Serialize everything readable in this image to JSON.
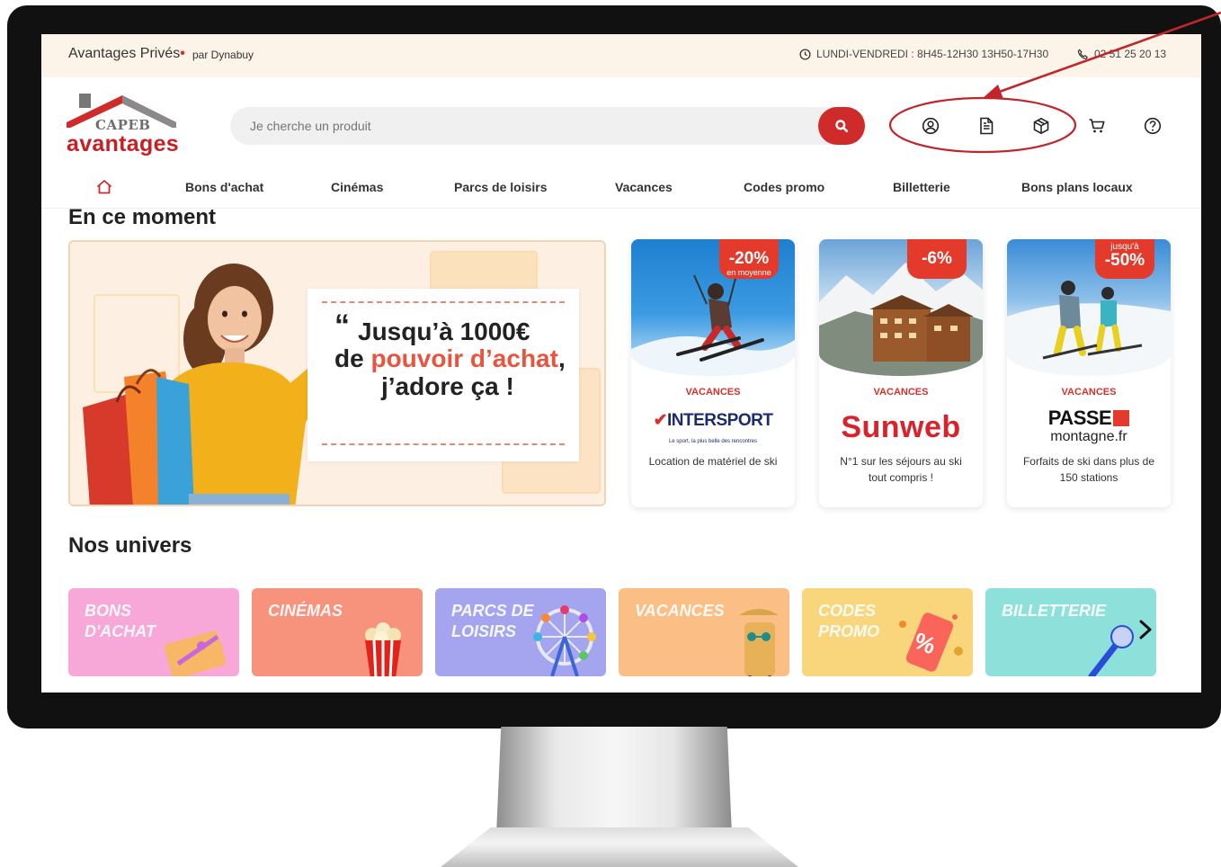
{
  "topbar": {
    "brand": "Avantages Privés",
    "brand_by": "par Dynabuy",
    "hours": "LUNDI-VENDREDI : 8H45-12H30 13H50-17H30",
    "phone": "02 51 25 20 13"
  },
  "logo": {
    "top": "CAPEB",
    "bottom": "avantages"
  },
  "search": {
    "placeholder": "Je cherche un produit"
  },
  "header_icons": [
    "account-icon",
    "document-icon",
    "package-icon",
    "cart-icon",
    "help-icon"
  ],
  "nav": {
    "items": [
      {
        "label": "Bons d'achat"
      },
      {
        "label": "Cinémas"
      },
      {
        "label": "Parcs de loisirs"
      },
      {
        "label": "Vacances"
      },
      {
        "label": "Codes promo"
      },
      {
        "label": "Billetterie"
      },
      {
        "label": "Bons plans locaux"
      }
    ]
  },
  "moment": {
    "title": "En ce moment",
    "hero": {
      "line1": "Jusqu’à 1000€",
      "line2_a": "de ",
      "line2_b": "pouvoir d’achat",
      "line2_c": ",",
      "line3": "j’adore ça !"
    },
    "cards": [
      {
        "badge_top": "",
        "badge": "-20%",
        "badge_sub": "en moyenne",
        "category": "VACANCES",
        "brand": "INTERSPORT",
        "brand_tag": "Le sport, la plus belle des rencontres",
        "desc": "Location de matériel de ski"
      },
      {
        "badge_top": "",
        "badge": "-6%",
        "badge_sub": "",
        "category": "VACANCES",
        "brand": "Sunweb",
        "brand_tag": "",
        "desc": "N°1 sur les séjours au ski tout compris !"
      },
      {
        "badge_top": "jusqu'à",
        "badge": "-50%",
        "badge_sub": "",
        "category": "VACANCES",
        "brand": "PASSE",
        "brand_tag": "montagne.fr",
        "desc": "Forfaits de ski dans plus de 150 stations"
      }
    ]
  },
  "universes": {
    "title": "Nos univers",
    "tiles": [
      {
        "label": "BONS\nD'ACHAT",
        "color": "#f7a8d8"
      },
      {
        "label": "CINÉMAS",
        "color": "#f7937c"
      },
      {
        "label": "PARCS DE\nLOISIRS",
        "color": "#a4a5ee"
      },
      {
        "label": "VACANCES",
        "color": "#fbbf86"
      },
      {
        "label": "CODES\nPROMO",
        "color": "#f9d67c"
      },
      {
        "label": "BILLETTERIE",
        "color": "#8ee1db"
      }
    ]
  },
  "colors": {
    "accent": "#cf2b2a",
    "annotation": "#c0262c"
  }
}
